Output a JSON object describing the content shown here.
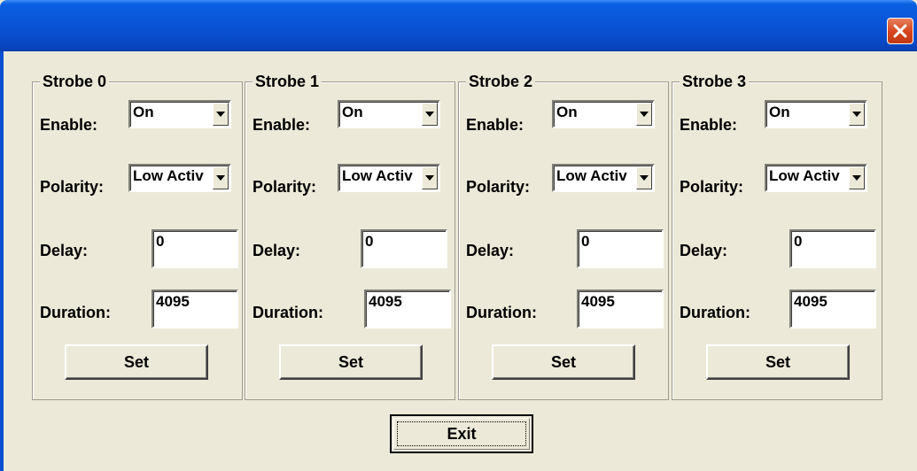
{
  "window": {
    "title": ""
  },
  "labels": {
    "enable": "Enable:",
    "polarity": "Polarity:",
    "delay": "Delay:",
    "duration": "Duration:"
  },
  "strobes": [
    {
      "title": "Strobe 0",
      "enable": "On",
      "polarity": "Low Activ",
      "delay": "0",
      "duration": "4095",
      "set_label": "Set"
    },
    {
      "title": "Strobe 1",
      "enable": "On",
      "polarity": "Low Activ",
      "delay": "0",
      "duration": "4095",
      "set_label": "Set"
    },
    {
      "title": "Strobe 2",
      "enable": "On",
      "polarity": "Low Activ",
      "delay": "0",
      "duration": "4095",
      "set_label": "Set"
    },
    {
      "title": "Strobe 3",
      "enable": "On",
      "polarity": "Low Activ",
      "delay": "0",
      "duration": "4095",
      "set_label": "Set"
    }
  ],
  "footer": {
    "exit_label": "Exit"
  },
  "icons": {
    "close": "close-icon",
    "dropdown": "chevron-down-icon"
  },
  "colors": {
    "titlebar": "#0a55d8",
    "close_button": "#d5431c",
    "dialog_background": "#ece9d8"
  }
}
